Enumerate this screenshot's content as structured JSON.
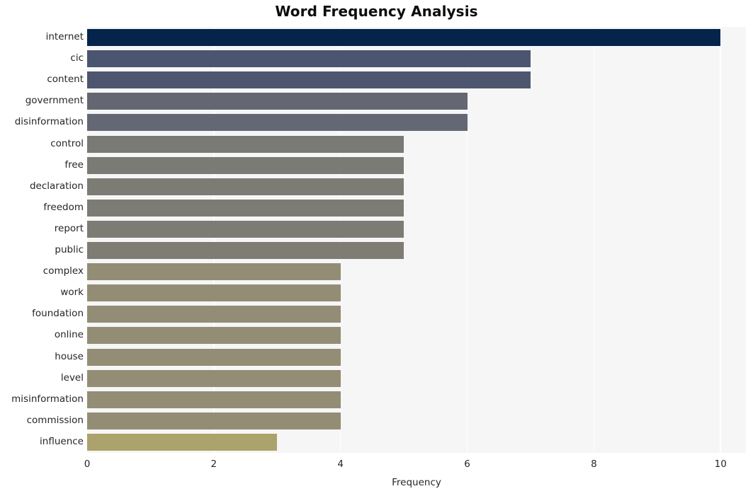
{
  "chart_data": {
    "type": "bar",
    "orientation": "horizontal",
    "title": "Word Frequency Analysis",
    "xlabel": "Frequency",
    "ylabel": "",
    "xlim": [
      0,
      10.4
    ],
    "xticks": [
      "0",
      "2",
      "4",
      "6",
      "8",
      "10"
    ],
    "xtick_values": [
      0,
      2,
      4,
      6,
      8,
      10
    ],
    "grid": "vertical-only",
    "legend": "none",
    "categories": [
      "internet",
      "cic",
      "content",
      "government",
      "disinformation",
      "control",
      "free",
      "declaration",
      "freedom",
      "report",
      "public",
      "complex",
      "work",
      "foundation",
      "online",
      "house",
      "level",
      "misinformation",
      "commission",
      "influence"
    ],
    "values": [
      10,
      7,
      7,
      6,
      6,
      5,
      5,
      5,
      5,
      5,
      5,
      4,
      4,
      4,
      4,
      4,
      4,
      4,
      4,
      3
    ],
    "bar_colors": [
      "#04244c",
      "#4b5570",
      "#4d566e",
      "#646772",
      "#646875",
      "#797a76",
      "#7b7b75",
      "#7c7c75",
      "#7d7c74",
      "#7d7c74",
      "#7e7c73",
      "#948d76",
      "#948d76",
      "#948d76",
      "#948d76",
      "#948d76",
      "#948d76",
      "#948d76",
      "#948d76",
      "#aca26b"
    ],
    "plot_background": "#f6f6f6",
    "grid_color": "#ffffff",
    "figure_background": "#ffffff"
  }
}
